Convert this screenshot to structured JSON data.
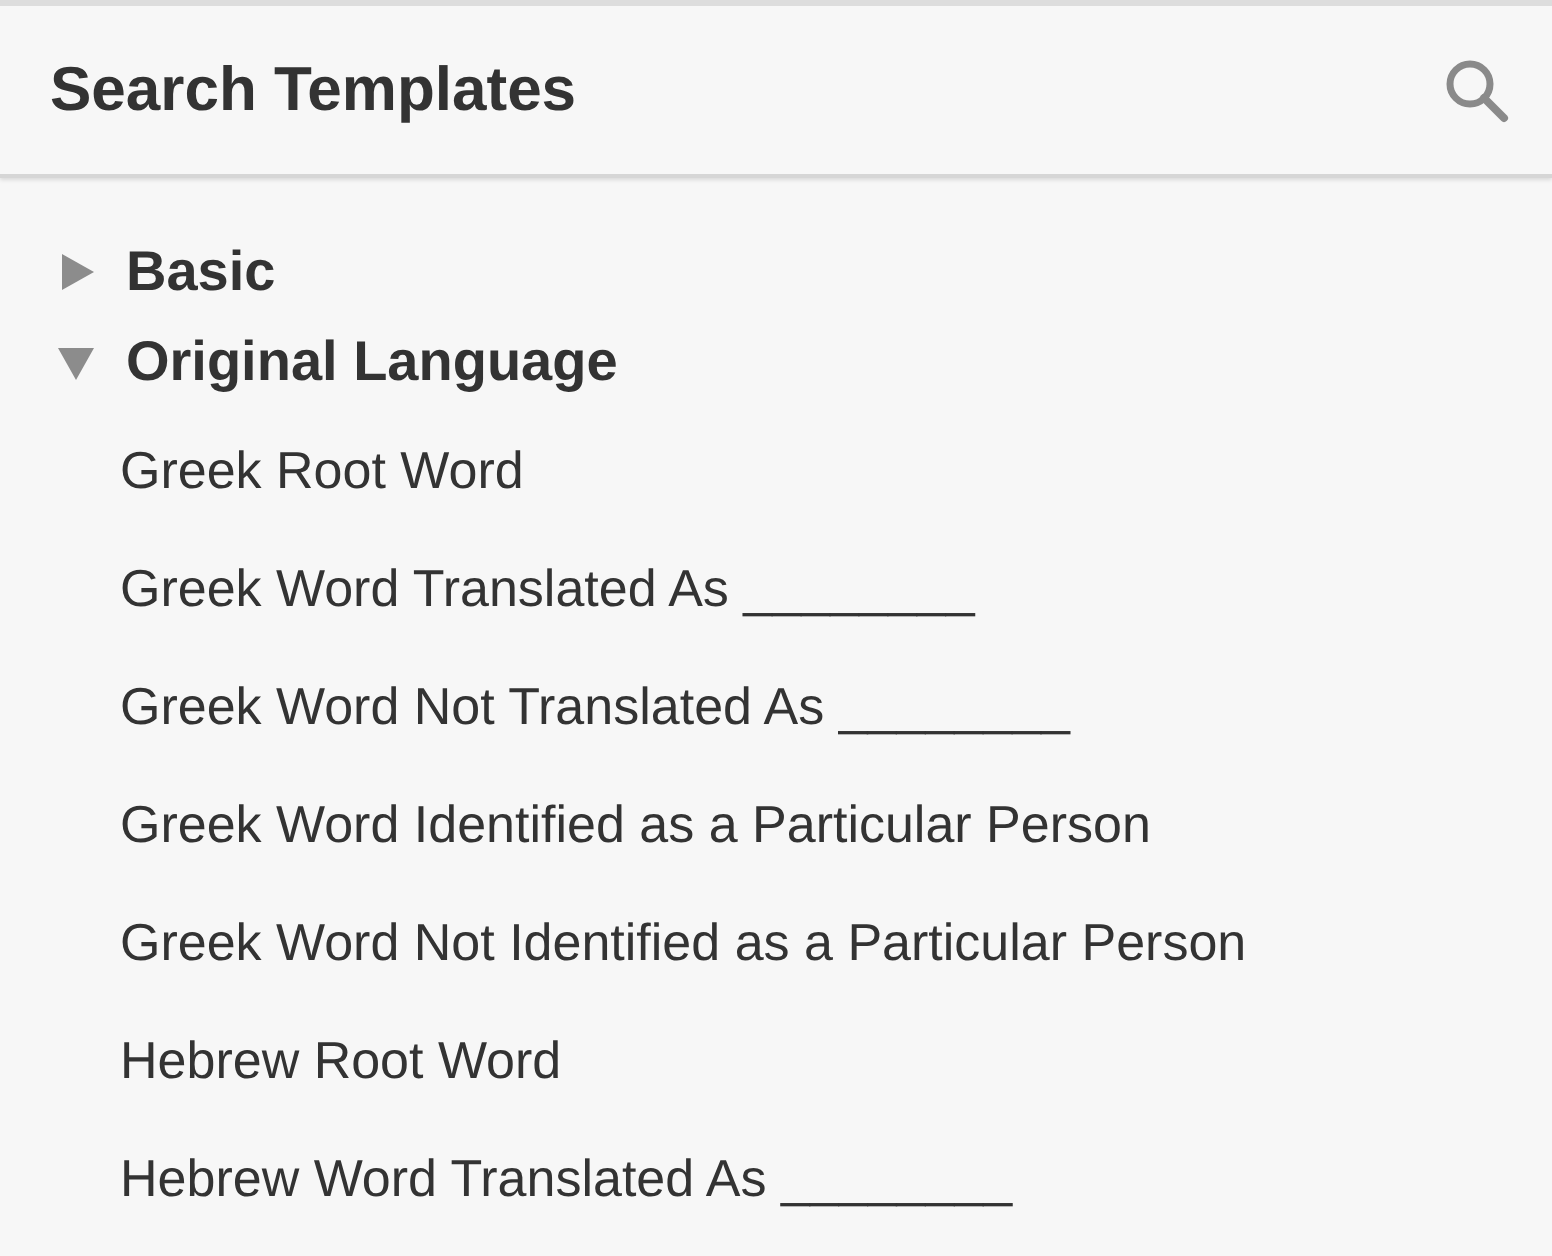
{
  "panel": {
    "title": "Search Templates"
  },
  "tree": [
    {
      "label": "Basic",
      "expanded": false
    },
    {
      "label": "Original Language",
      "expanded": true,
      "children": [
        {
          "label": "Greek Root Word"
        },
        {
          "label": "Greek Word Translated As ________"
        },
        {
          "label": "Greek Word Not Translated As ________"
        },
        {
          "label": "Greek Word Identified as a Particular Person"
        },
        {
          "label": "Greek Word Not Identified as a Particular Person"
        },
        {
          "label": "Hebrew Root Word"
        },
        {
          "label": "Hebrew Word Translated As ________"
        }
      ]
    }
  ]
}
